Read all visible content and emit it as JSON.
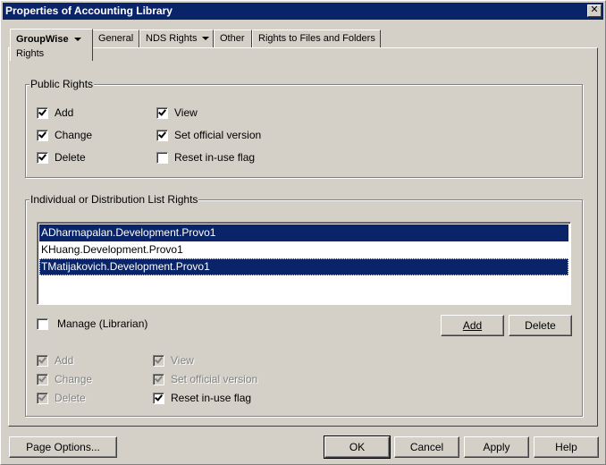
{
  "window": {
    "title": "Properties of Accounting Library",
    "close_label": "✕"
  },
  "tabs": [
    {
      "label": "GroupWise",
      "sub": "Rights",
      "dropdown": true
    },
    {
      "label": "General",
      "dropdown": false
    },
    {
      "label": "NDS Rights",
      "dropdown": true
    },
    {
      "label": "Other",
      "dropdown": false
    },
    {
      "label": "Rights to Files and Folders",
      "dropdown": false
    }
  ],
  "public_rights": {
    "label": "Public Rights",
    "items": [
      {
        "label": "Add",
        "checked": true
      },
      {
        "label": "Change",
        "checked": true
      },
      {
        "label": "Delete",
        "checked": true
      },
      {
        "label": "View",
        "checked": true
      },
      {
        "label": "Set official version",
        "checked": true
      },
      {
        "label": "Reset in-use flag",
        "checked": false
      }
    ]
  },
  "individual_rights": {
    "label": "Individual or Distribution List Rights",
    "list": [
      {
        "name": "ADharmapalan.Development.Provo1",
        "selected": true
      },
      {
        "name": "KHuang.Development.Provo1",
        "selected": false
      },
      {
        "name": "TMatijakovich.Development.Provo1",
        "selected": true
      }
    ],
    "manage_label": "Manage (Librarian)",
    "add_label": "Add",
    "delete_label": "Delete",
    "items": [
      {
        "label": "Add",
        "checked": true,
        "enabled": false
      },
      {
        "label": "Change",
        "checked": true,
        "enabled": false
      },
      {
        "label": "Delete",
        "checked": true,
        "enabled": false
      },
      {
        "label": "View",
        "checked": true,
        "enabled": false
      },
      {
        "label": "Set official version",
        "checked": true,
        "enabled": false
      },
      {
        "label": "Reset in-use flag",
        "checked": true,
        "enabled": true
      }
    ]
  },
  "footer": {
    "page_options": "Page Options...",
    "ok": "OK",
    "cancel": "Cancel",
    "apply": "Apply",
    "help": "Help"
  }
}
